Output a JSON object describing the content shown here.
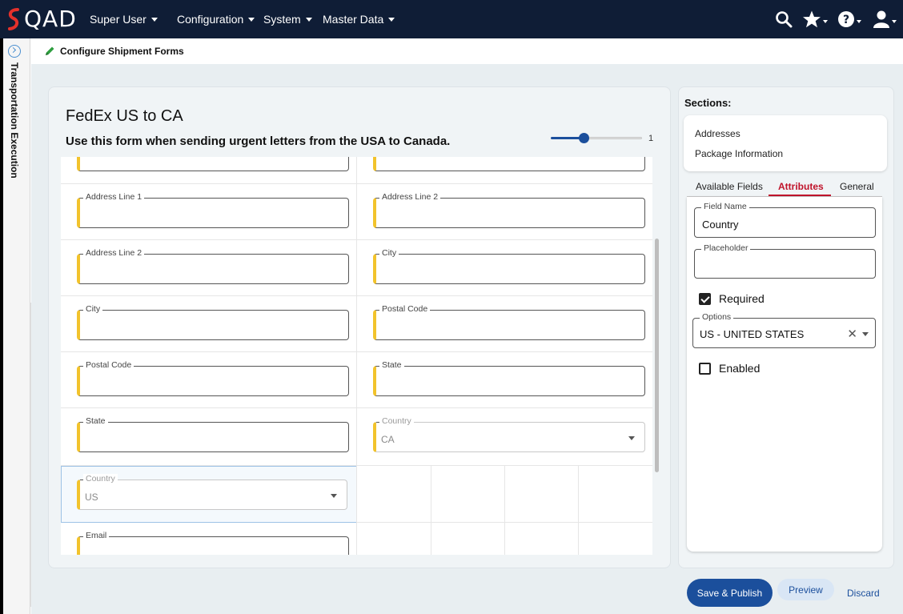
{
  "topbar": {
    "logo": "QAD",
    "menus": [
      "Super User",
      "Configuration",
      "System",
      "Master Data"
    ]
  },
  "rail": {
    "label": "Transportation Execution"
  },
  "breadcrumb": {
    "title": "Configure Shipment Forms"
  },
  "form": {
    "title": "FedEx US to CA",
    "subtitle": "Use this form when sending urgent letters from the USA to Canada.",
    "slider": {
      "value": 1,
      "fill_fraction": 0.35
    },
    "rows": [
      {
        "left": {
          "label": "Address Line 1"
        },
        "right": {
          "label": "Address Line 2"
        }
      },
      {
        "left": {
          "label": "Address Line 2"
        },
        "right": {
          "label": "City"
        }
      },
      {
        "left": {
          "label": "City"
        },
        "right": {
          "label": "Postal Code"
        }
      },
      {
        "left": {
          "label": "Postal Code"
        },
        "right": {
          "label": "State"
        }
      },
      {
        "left": {
          "label": "State"
        },
        "right": {
          "label": "Country",
          "value": "CA"
        }
      },
      {
        "left": {
          "label": "Country",
          "value": "US"
        }
      },
      {
        "left": {
          "label": "Email"
        }
      }
    ]
  },
  "sections": {
    "title": "Sections:",
    "items": [
      "Addresses",
      "Package Information"
    ]
  },
  "tabs": [
    "Available Fields",
    "Attributes",
    "General"
  ],
  "attributes": {
    "field_name_label": "Field Name",
    "field_name_value": "Country",
    "placeholder_label": "Placeholder",
    "placeholder_value": "",
    "required_label": "Required",
    "required_checked": true,
    "options_label": "Options",
    "options_value": "US - UNITED STATES",
    "enabled_label": "Enabled",
    "enabled_checked": false
  },
  "buttons": {
    "save": "Save & Publish",
    "preview": "Preview",
    "discard": "Discard"
  },
  "colors": {
    "topbar": "#0f1d36",
    "primary": "#1b4f9c",
    "active_tab": "#c0142b",
    "required_accent": "#f2c32c"
  }
}
